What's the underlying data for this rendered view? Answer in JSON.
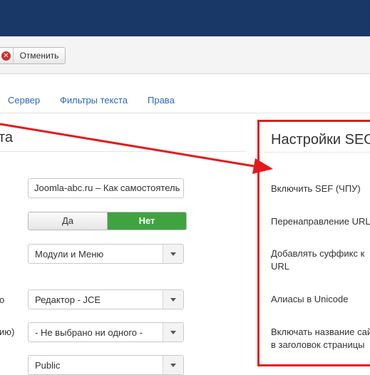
{
  "toolbar": {
    "cancel_label": "Отменить"
  },
  "tabs": [
    "Сервер",
    "Фильтры текста",
    "Права"
  ],
  "left": {
    "title_fragment": "та",
    "site_name_value": "Joomla-abc.ru – Как самостоятель",
    "toggle": {
      "yes": "Да",
      "no": "Нет",
      "selected": "Нет"
    },
    "menu_select": "Модули и Меню",
    "editor_label_fragment": "о",
    "editor_select": "Редактор - JCE",
    "captcha_label_fragment": "ию)",
    "captcha_select": "- Не выбрано ни одного -",
    "access_select": "Public"
  },
  "seo": {
    "title": "Настройки SEO",
    "items": [
      "Включить SEF (ЧПУ)",
      "Перенаправление URL",
      "Добавлять суффикс к",
      "URL",
      "Алиасы в Unicode",
      "Включать название сайт",
      "в заголовок страницы"
    ]
  },
  "colors": {
    "topbar": "#1a3867",
    "highlight": "#e5191b",
    "toggle_on": "#3fa440",
    "link": "#2a69b8"
  },
  "icons": [
    "cancel-icon",
    "chevron-down-icon",
    "arrow-annotation"
  ]
}
